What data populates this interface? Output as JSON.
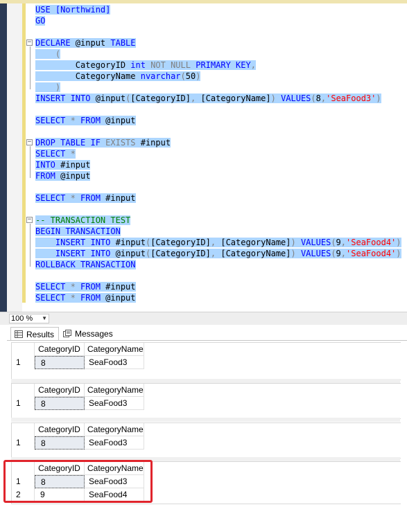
{
  "editor": {
    "lines": [
      [
        {
          "t": "USE [Northwind]",
          "c": "kw"
        }
      ],
      [
        {
          "t": "GO",
          "c": "kw"
        }
      ],
      [],
      [
        {
          "t": "DECLARE ",
          "c": "kw"
        },
        {
          "t": "@input ",
          "c": "tx"
        },
        {
          "t": "TABLE",
          "c": "kw"
        }
      ],
      [
        {
          "t": "    (",
          "c": "gr"
        }
      ],
      [
        {
          "t": "        CategoryID ",
          "c": "tx"
        },
        {
          "t": "int ",
          "c": "kw"
        },
        {
          "t": "NOT NULL ",
          "c": "gr"
        },
        {
          "t": "PRIMARY KEY",
          "c": "kw"
        },
        {
          "t": ",",
          "c": "gr"
        }
      ],
      [
        {
          "t": "        CategoryName ",
          "c": "tx"
        },
        {
          "t": "nvarchar",
          "c": "kw"
        },
        {
          "t": "(",
          "c": "gr"
        },
        {
          "t": "50",
          "c": "tx"
        },
        {
          "t": ")",
          "c": "gr"
        }
      ],
      [
        {
          "t": "    )",
          "c": "gr"
        }
      ],
      [
        {
          "t": "INSERT INTO ",
          "c": "kw"
        },
        {
          "t": "@input",
          "c": "tx"
        },
        {
          "t": "(",
          "c": "gr"
        },
        {
          "t": "[CategoryID]",
          "c": "tx"
        },
        {
          "t": ", ",
          "c": "gr"
        },
        {
          "t": "[CategoryName]",
          "c": "tx"
        },
        {
          "t": ") ",
          "c": "gr"
        },
        {
          "t": "VALUES",
          "c": "kw"
        },
        {
          "t": "(",
          "c": "gr"
        },
        {
          "t": "8",
          "c": "tx"
        },
        {
          "t": ",",
          "c": "gr"
        },
        {
          "t": "'SeaFood3'",
          "c": "str"
        },
        {
          "t": ")",
          "c": "gr"
        }
      ],
      [],
      [
        {
          "t": "SELECT ",
          "c": "kw"
        },
        {
          "t": "* ",
          "c": "gr"
        },
        {
          "t": "FROM ",
          "c": "kw"
        },
        {
          "t": "@input",
          "c": "tx"
        }
      ],
      [],
      [
        {
          "t": "DROP TABLE IF ",
          "c": "kw"
        },
        {
          "t": "EXISTS ",
          "c": "gr"
        },
        {
          "t": "#input",
          "c": "tx"
        }
      ],
      [
        {
          "t": "SELECT ",
          "c": "kw"
        },
        {
          "t": "*",
          "c": "gr"
        }
      ],
      [
        {
          "t": "INTO ",
          "c": "kw"
        },
        {
          "t": "#input",
          "c": "tx"
        }
      ],
      [
        {
          "t": "FROM ",
          "c": "kw"
        },
        {
          "t": "@input",
          "c": "tx"
        }
      ],
      [],
      [
        {
          "t": "SELECT ",
          "c": "kw"
        },
        {
          "t": "* ",
          "c": "gr"
        },
        {
          "t": "FROM ",
          "c": "kw"
        },
        {
          "t": "#input",
          "c": "tx"
        }
      ],
      [],
      [
        {
          "t": "-- TRANSACTION TEST",
          "c": "cm"
        }
      ],
      [
        {
          "t": "BEGIN TRANSACTION",
          "c": "kw"
        }
      ],
      [
        {
          "t": "    INSERT INTO ",
          "c": "kw"
        },
        {
          "t": "#input",
          "c": "tx"
        },
        {
          "t": "(",
          "c": "gr"
        },
        {
          "t": "[CategoryID]",
          "c": "tx"
        },
        {
          "t": ", ",
          "c": "gr"
        },
        {
          "t": "[CategoryName]",
          "c": "tx"
        },
        {
          "t": ") ",
          "c": "gr"
        },
        {
          "t": "VALUES",
          "c": "kw"
        },
        {
          "t": "(",
          "c": "gr"
        },
        {
          "t": "9",
          "c": "tx"
        },
        {
          "t": ",",
          "c": "gr"
        },
        {
          "t": "'SeaFood4'",
          "c": "str"
        },
        {
          "t": ")",
          "c": "gr"
        }
      ],
      [
        {
          "t": "    INSERT INTO ",
          "c": "kw"
        },
        {
          "t": "@input",
          "c": "tx"
        },
        {
          "t": "(",
          "c": "gr"
        },
        {
          "t": "[CategoryID]",
          "c": "tx"
        },
        {
          "t": ", ",
          "c": "gr"
        },
        {
          "t": "[CategoryName]",
          "c": "tx"
        },
        {
          "t": ") ",
          "c": "gr"
        },
        {
          "t": "VALUES",
          "c": "kw"
        },
        {
          "t": "(",
          "c": "gr"
        },
        {
          "t": "9",
          "c": "tx"
        },
        {
          "t": ",",
          "c": "gr"
        },
        {
          "t": "'SeaFood4'",
          "c": "str"
        },
        {
          "t": ")",
          "c": "gr"
        }
      ],
      [
        {
          "t": "ROLLBACK TRANSACTION",
          "c": "kw"
        }
      ],
      [],
      [
        {
          "t": "SELECT ",
          "c": "kw"
        },
        {
          "t": "* ",
          "c": "gr"
        },
        {
          "t": "FROM ",
          "c": "kw"
        },
        {
          "t": "#input",
          "c": "tx"
        }
      ],
      [
        {
          "t": "SELECT ",
          "c": "kw"
        },
        {
          "t": "* ",
          "c": "gr"
        },
        {
          "t": "FROM ",
          "c": "kw"
        },
        {
          "t": "@input",
          "c": "tx"
        }
      ]
    ]
  },
  "zoom": {
    "value": "100 %"
  },
  "tabs": {
    "results": "Results",
    "messages": "Messages"
  },
  "grids": [
    {
      "columns": [
        "CategoryID",
        "CategoryName"
      ],
      "rows": [
        [
          "1",
          "8",
          "SeaFood3"
        ]
      ]
    },
    {
      "columns": [
        "CategoryID",
        "CategoryName"
      ],
      "rows": [
        [
          "1",
          "8",
          "SeaFood3"
        ]
      ]
    },
    {
      "columns": [
        "CategoryID",
        "CategoryName"
      ],
      "rows": [
        [
          "1",
          "8",
          "SeaFood3"
        ]
      ]
    },
    {
      "columns": [
        "CategoryID",
        "CategoryName"
      ],
      "rows": [
        [
          "1",
          "8",
          "SeaFood3"
        ],
        [
          "2",
          "9",
          "SeaFood4"
        ]
      ]
    }
  ],
  "colors": {
    "selection": "#add6ff",
    "keyword": "#0000ff",
    "string": "#ff0000",
    "comment": "#008000",
    "highlight_box": "#e0242c"
  }
}
